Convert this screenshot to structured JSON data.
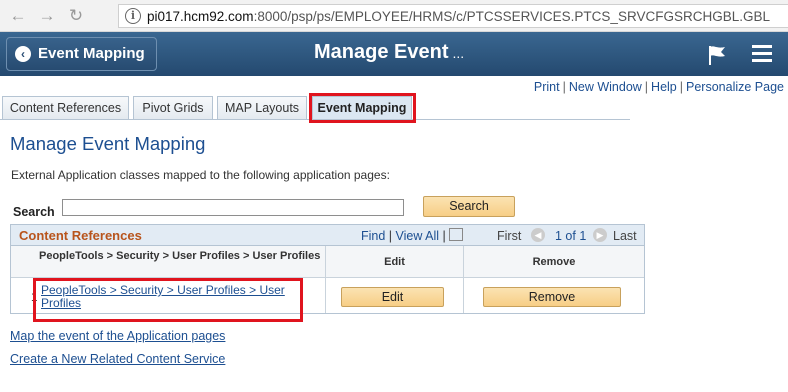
{
  "browser": {
    "back_icon": "arrow-left-icon",
    "forward_icon": "arrow-right-icon",
    "reload_icon": "reload-icon",
    "url_host": "pi017.hcm92.com",
    "url_path": ":8000/psp/ps/EMPLOYEE/HRMS/c/PTCSSERVICES.PTCS_SRVCFGSRCHGBL.GBL"
  },
  "header": {
    "back_label": "Event Mapping",
    "title": "Manage Event",
    "title_ellipsis": "...",
    "brand_color": "#2b527a"
  },
  "page_links": {
    "print": "Print",
    "new_window": "New Window",
    "help": "Help",
    "personalize": "Personalize Page"
  },
  "tabs": [
    {
      "label": "Content References"
    },
    {
      "label": "Pivot Grids"
    },
    {
      "label": "MAP Layouts"
    },
    {
      "label": "Event Mapping"
    }
  ],
  "main": {
    "heading": "Manage Event Mapping",
    "description": "External Application classes mapped to the following application pages:",
    "search_label": "Search",
    "search_value": "",
    "search_button": "Search"
  },
  "grid": {
    "title": "Content References",
    "find": "Find",
    "view_all": "View All",
    "first": "First",
    "count": "1 of 1",
    "last": "Last",
    "col_content_ref": "PeopleTools > Security > User Profiles > User Profiles",
    "col_edit": "Edit",
    "col_remove": "Remove",
    "rows": [
      {
        "num": "1",
        "content_ref": "PeopleTools > Security > User Profiles > User Profiles",
        "edit": "Edit",
        "remove": "Remove"
      }
    ]
  },
  "links": {
    "map_event": "Map the event of the Application pages",
    "create_service": "Create a New Related Content Service"
  }
}
